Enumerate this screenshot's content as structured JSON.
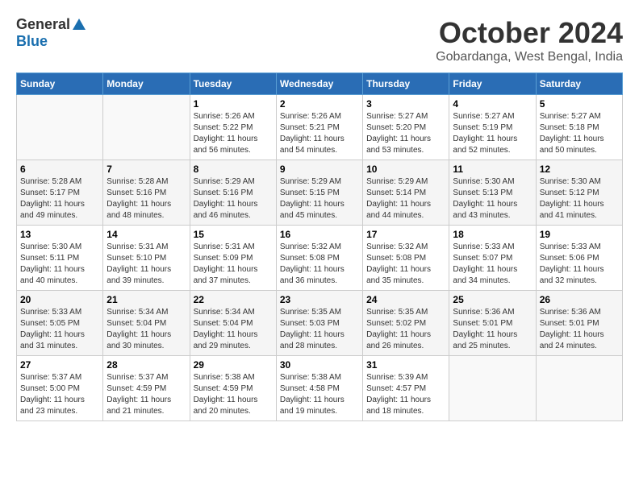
{
  "logo": {
    "general": "General",
    "blue": "Blue"
  },
  "title": "October 2024",
  "location": "Gobardanga, West Bengal, India",
  "headers": [
    "Sunday",
    "Monday",
    "Tuesday",
    "Wednesday",
    "Thursday",
    "Friday",
    "Saturday"
  ],
  "weeks": [
    [
      {
        "day": "",
        "info": ""
      },
      {
        "day": "",
        "info": ""
      },
      {
        "day": "1",
        "info": "Sunrise: 5:26 AM\nSunset: 5:22 PM\nDaylight: 11 hours and 56 minutes."
      },
      {
        "day": "2",
        "info": "Sunrise: 5:26 AM\nSunset: 5:21 PM\nDaylight: 11 hours and 54 minutes."
      },
      {
        "day": "3",
        "info": "Sunrise: 5:27 AM\nSunset: 5:20 PM\nDaylight: 11 hours and 53 minutes."
      },
      {
        "day": "4",
        "info": "Sunrise: 5:27 AM\nSunset: 5:19 PM\nDaylight: 11 hours and 52 minutes."
      },
      {
        "day": "5",
        "info": "Sunrise: 5:27 AM\nSunset: 5:18 PM\nDaylight: 11 hours and 50 minutes."
      }
    ],
    [
      {
        "day": "6",
        "info": "Sunrise: 5:28 AM\nSunset: 5:17 PM\nDaylight: 11 hours and 49 minutes."
      },
      {
        "day": "7",
        "info": "Sunrise: 5:28 AM\nSunset: 5:16 PM\nDaylight: 11 hours and 48 minutes."
      },
      {
        "day": "8",
        "info": "Sunrise: 5:29 AM\nSunset: 5:16 PM\nDaylight: 11 hours and 46 minutes."
      },
      {
        "day": "9",
        "info": "Sunrise: 5:29 AM\nSunset: 5:15 PM\nDaylight: 11 hours and 45 minutes."
      },
      {
        "day": "10",
        "info": "Sunrise: 5:29 AM\nSunset: 5:14 PM\nDaylight: 11 hours and 44 minutes."
      },
      {
        "day": "11",
        "info": "Sunrise: 5:30 AM\nSunset: 5:13 PM\nDaylight: 11 hours and 43 minutes."
      },
      {
        "day": "12",
        "info": "Sunrise: 5:30 AM\nSunset: 5:12 PM\nDaylight: 11 hours and 41 minutes."
      }
    ],
    [
      {
        "day": "13",
        "info": "Sunrise: 5:30 AM\nSunset: 5:11 PM\nDaylight: 11 hours and 40 minutes."
      },
      {
        "day": "14",
        "info": "Sunrise: 5:31 AM\nSunset: 5:10 PM\nDaylight: 11 hours and 39 minutes."
      },
      {
        "day": "15",
        "info": "Sunrise: 5:31 AM\nSunset: 5:09 PM\nDaylight: 11 hours and 37 minutes."
      },
      {
        "day": "16",
        "info": "Sunrise: 5:32 AM\nSunset: 5:08 PM\nDaylight: 11 hours and 36 minutes."
      },
      {
        "day": "17",
        "info": "Sunrise: 5:32 AM\nSunset: 5:08 PM\nDaylight: 11 hours and 35 minutes."
      },
      {
        "day": "18",
        "info": "Sunrise: 5:33 AM\nSunset: 5:07 PM\nDaylight: 11 hours and 34 minutes."
      },
      {
        "day": "19",
        "info": "Sunrise: 5:33 AM\nSunset: 5:06 PM\nDaylight: 11 hours and 32 minutes."
      }
    ],
    [
      {
        "day": "20",
        "info": "Sunrise: 5:33 AM\nSunset: 5:05 PM\nDaylight: 11 hours and 31 minutes."
      },
      {
        "day": "21",
        "info": "Sunrise: 5:34 AM\nSunset: 5:04 PM\nDaylight: 11 hours and 30 minutes."
      },
      {
        "day": "22",
        "info": "Sunrise: 5:34 AM\nSunset: 5:04 PM\nDaylight: 11 hours and 29 minutes."
      },
      {
        "day": "23",
        "info": "Sunrise: 5:35 AM\nSunset: 5:03 PM\nDaylight: 11 hours and 28 minutes."
      },
      {
        "day": "24",
        "info": "Sunrise: 5:35 AM\nSunset: 5:02 PM\nDaylight: 11 hours and 26 minutes."
      },
      {
        "day": "25",
        "info": "Sunrise: 5:36 AM\nSunset: 5:01 PM\nDaylight: 11 hours and 25 minutes."
      },
      {
        "day": "26",
        "info": "Sunrise: 5:36 AM\nSunset: 5:01 PM\nDaylight: 11 hours and 24 minutes."
      }
    ],
    [
      {
        "day": "27",
        "info": "Sunrise: 5:37 AM\nSunset: 5:00 PM\nDaylight: 11 hours and 23 minutes."
      },
      {
        "day": "28",
        "info": "Sunrise: 5:37 AM\nSunset: 4:59 PM\nDaylight: 11 hours and 21 minutes."
      },
      {
        "day": "29",
        "info": "Sunrise: 5:38 AM\nSunset: 4:59 PM\nDaylight: 11 hours and 20 minutes."
      },
      {
        "day": "30",
        "info": "Sunrise: 5:38 AM\nSunset: 4:58 PM\nDaylight: 11 hours and 19 minutes."
      },
      {
        "day": "31",
        "info": "Sunrise: 5:39 AM\nSunset: 4:57 PM\nDaylight: 11 hours and 18 minutes."
      },
      {
        "day": "",
        "info": ""
      },
      {
        "day": "",
        "info": ""
      }
    ]
  ]
}
